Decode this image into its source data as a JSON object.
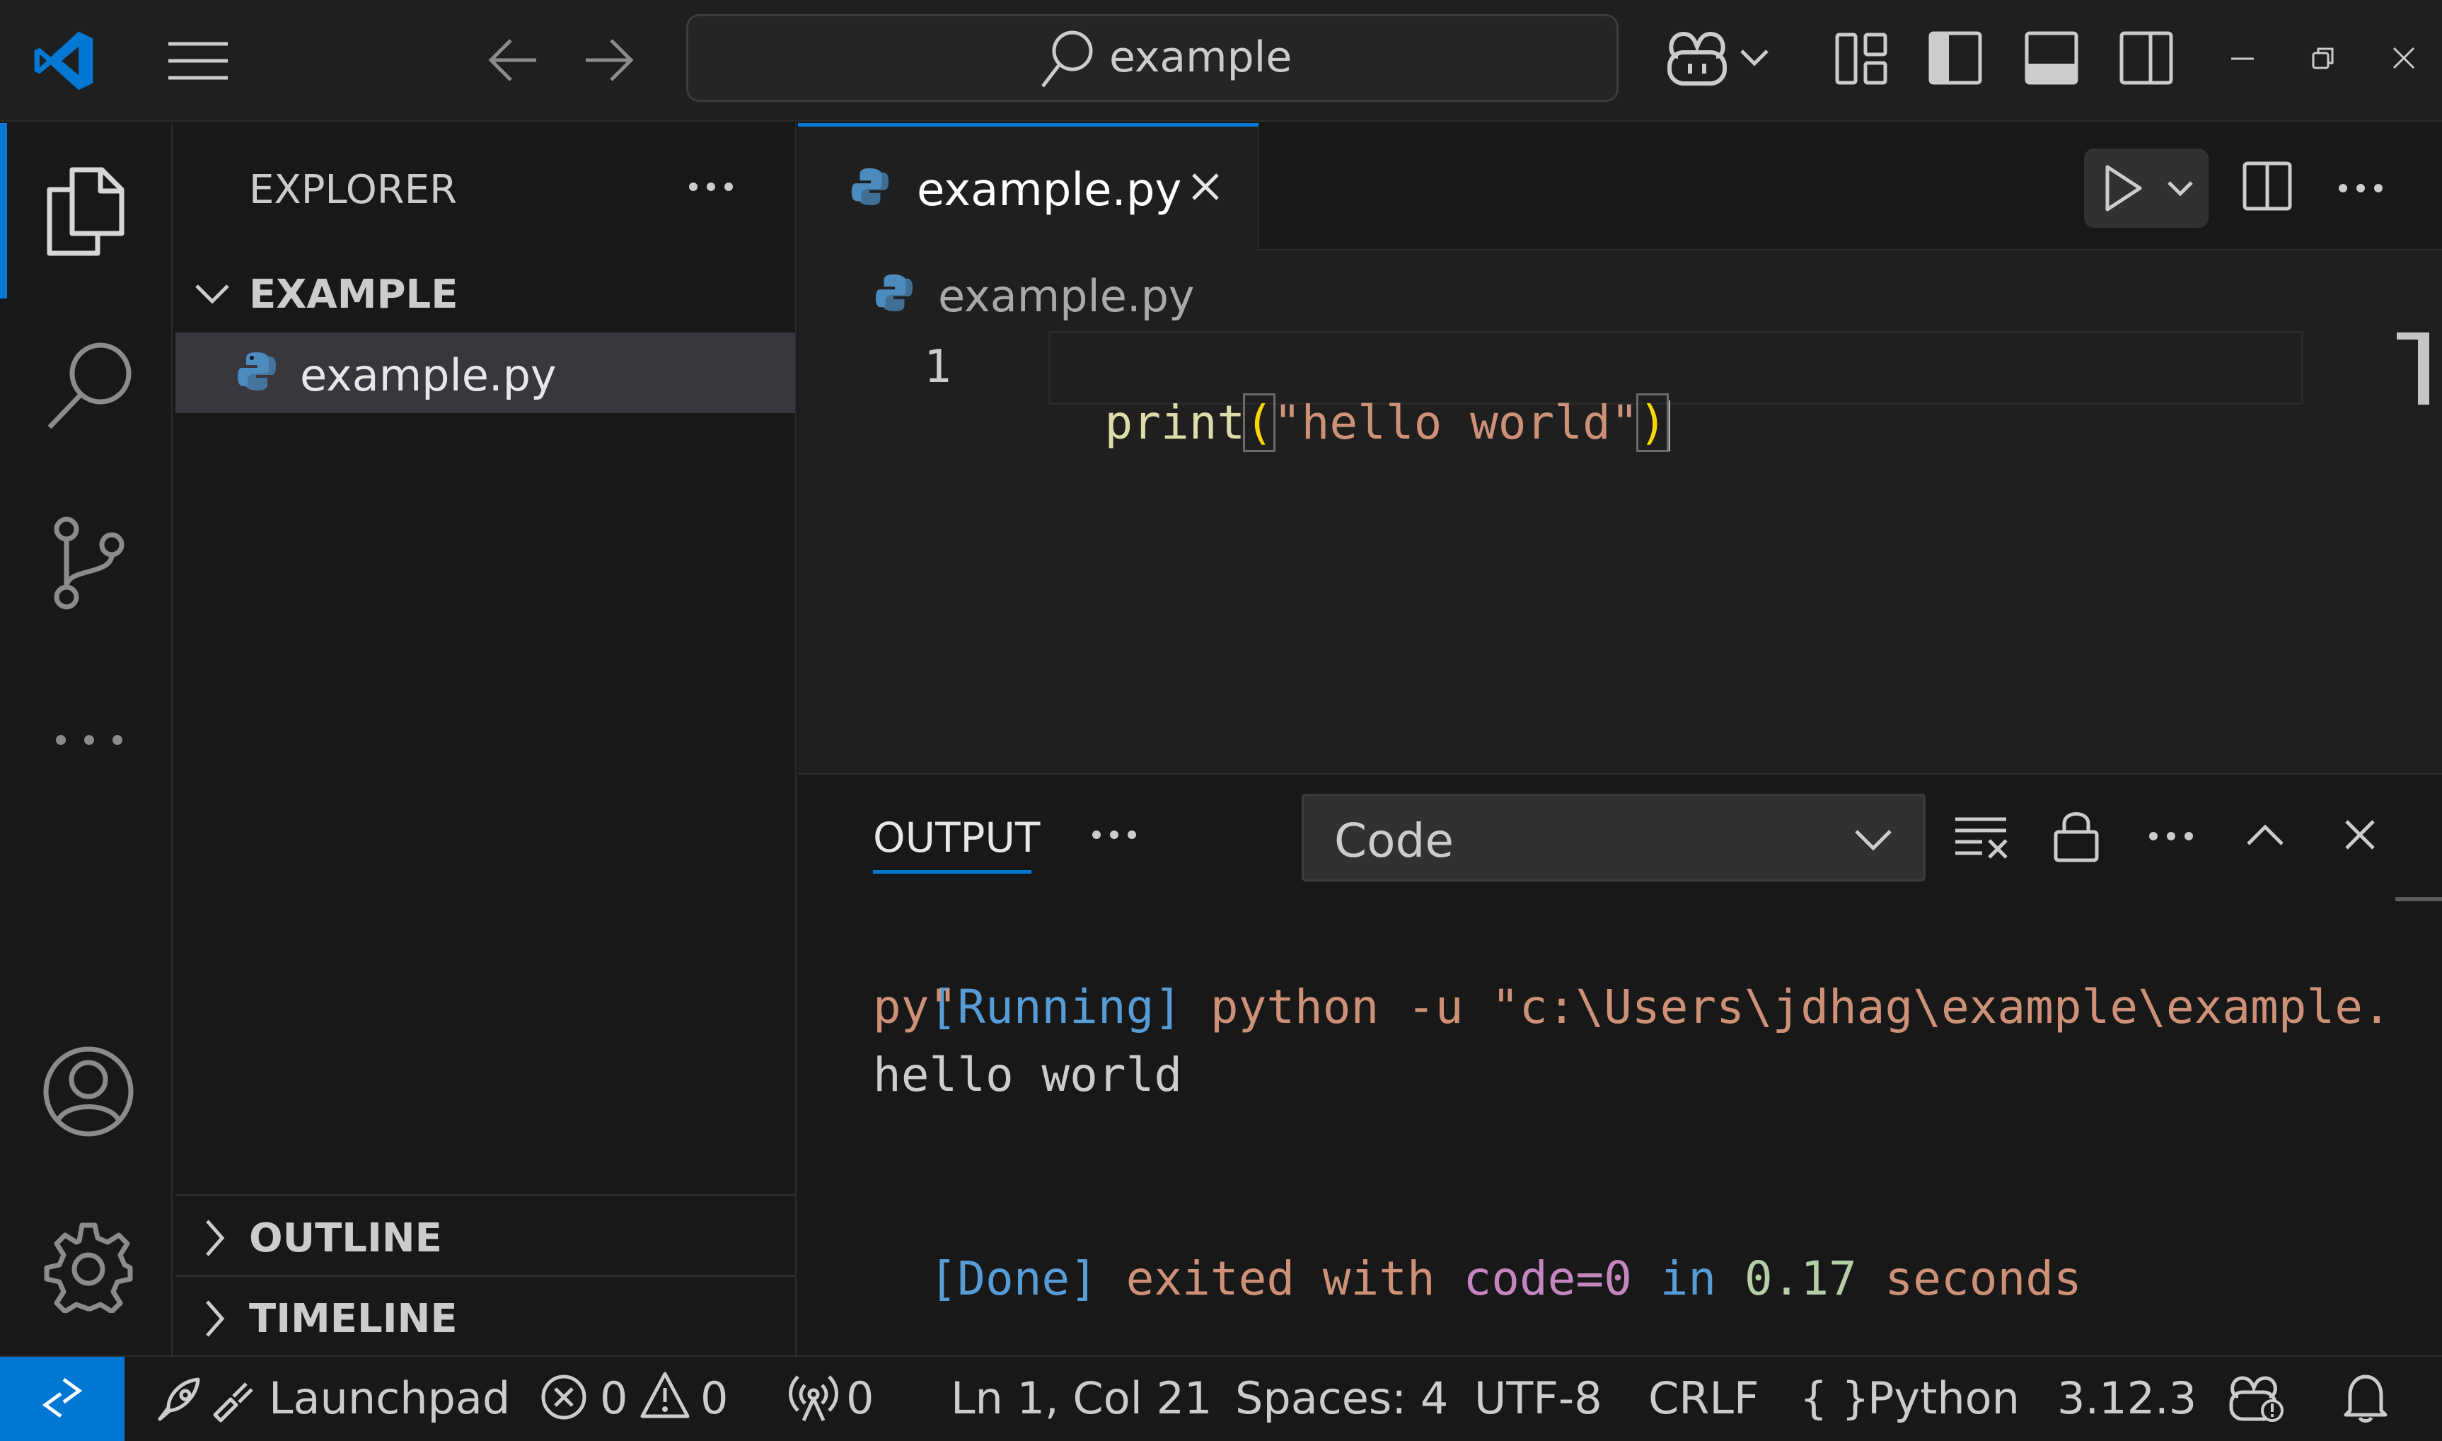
{
  "titlebar": {
    "search_text": "example",
    "icons": [
      "vscode-logo-icon",
      "menu-icon",
      "back-arrow-icon",
      "forward-arrow-icon",
      "search-icon",
      "copilot-icon",
      "chevron-down-icon",
      "customize-layout-icon",
      "toggle-sidebar-icon",
      "toggle-panel-icon",
      "toggle-secondary-sidebar-icon",
      "minimize-icon",
      "restore-icon",
      "close-icon"
    ]
  },
  "activitybar": {
    "items": [
      "explorer-icon",
      "search-icon",
      "source-control-icon",
      "more-icon"
    ],
    "bottom": [
      "accounts-icon",
      "manage-gear-icon"
    ],
    "active": "explorer-icon"
  },
  "sidebar": {
    "title": "EXPLORER",
    "folder": "EXAMPLE",
    "file": "example.py",
    "outline": "OUTLINE",
    "timeline": "TIMELINE"
  },
  "editor": {
    "tab_label": "example.py",
    "breadcrumb": "example.py",
    "line_number": "1",
    "code": {
      "func": "print",
      "open_paren": "(",
      "string": "\"hello world\"",
      "close_paren": ")"
    }
  },
  "panel": {
    "tab": "OUTPUT",
    "more": "···",
    "channel": "Code",
    "lines": [
      {
        "tag": "[Running]",
        "text": " python -u \"c:\\Users\\jdhag\\example\\example.",
        "cont": "py\""
      },
      {
        "plain": "hello world"
      },
      {
        "tag": "[Done]",
        "t1": " exited with ",
        "code": "code=0",
        "t2": " in ",
        "num": "0.17",
        "t3": " seconds"
      }
    ]
  },
  "statusbar": {
    "launchpad": "Launchpad",
    "errors": "0",
    "warnings": "0",
    "ports": "0",
    "cursor": "Ln 1, Col 21",
    "spaces": "Spaces: 4",
    "encoding": "UTF-8",
    "eol": "CRLF",
    "language": "Python",
    "interpreter": "3.12.3"
  },
  "colors": {
    "accent": "#0078d4",
    "tag_blue": "#569cd6",
    "output_orange": "#ce9178",
    "func_yellow": "#dcdcaa",
    "bracket_gold": "#ffd700",
    "code_purple": "#c586c0",
    "number_green": "#b5cea8"
  }
}
